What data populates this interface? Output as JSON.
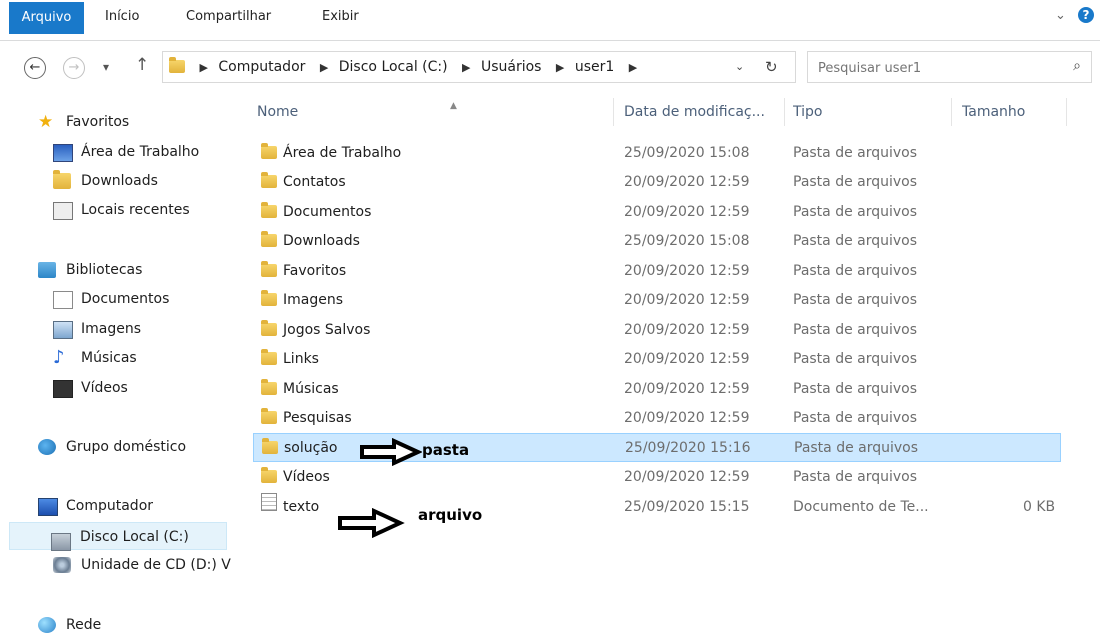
{
  "ribbon": {
    "tabs": [
      "Arquivo",
      "Início",
      "Compartilhar",
      "Exibir"
    ],
    "help": "?"
  },
  "nav": {
    "back": "←",
    "forward": "→",
    "recent": "▾",
    "up": "↑",
    "breadcrumbs": [
      "Computador",
      "Disco Local (C:)",
      "Usuários",
      "user1"
    ],
    "search_placeholder": "Pesquisar user1"
  },
  "sidebar": {
    "favorites": {
      "label": "Favoritos",
      "items": [
        "Área de Trabalho",
        "Downloads",
        "Locais recentes"
      ]
    },
    "libraries": {
      "label": "Bibliotecas",
      "items": [
        "Documentos",
        "Imagens",
        "Músicas",
        "Vídeos"
      ]
    },
    "homegroup": {
      "label": "Grupo doméstico"
    },
    "computer": {
      "label": "Computador",
      "items": [
        "Disco Local (C:)",
        "Unidade de CD (D:) V"
      ]
    },
    "network": {
      "label": "Rede"
    }
  },
  "columns": [
    "Nome",
    "Data de modificaç...",
    "Tipo",
    "Tamanho"
  ],
  "files": [
    {
      "name": "Área de Trabalho",
      "date": "25/09/2020 15:08",
      "type": "Pasta de arquivos",
      "size": ""
    },
    {
      "name": "Contatos",
      "date": "20/09/2020 12:59",
      "type": "Pasta de arquivos",
      "size": ""
    },
    {
      "name": "Documentos",
      "date": "20/09/2020 12:59",
      "type": "Pasta de arquivos",
      "size": ""
    },
    {
      "name": "Downloads",
      "date": "25/09/2020 15:08",
      "type": "Pasta de arquivos",
      "size": ""
    },
    {
      "name": "Favoritos",
      "date": "20/09/2020 12:59",
      "type": "Pasta de arquivos",
      "size": ""
    },
    {
      "name": "Imagens",
      "date": "20/09/2020 12:59",
      "type": "Pasta de arquivos",
      "size": ""
    },
    {
      "name": "Jogos Salvos",
      "date": "20/09/2020 12:59",
      "type": "Pasta de arquivos",
      "size": ""
    },
    {
      "name": "Links",
      "date": "20/09/2020 12:59",
      "type": "Pasta de arquivos",
      "size": ""
    },
    {
      "name": "Músicas",
      "date": "20/09/2020 12:59",
      "type": "Pasta de arquivos",
      "size": ""
    },
    {
      "name": "Pesquisas",
      "date": "20/09/2020 12:59",
      "type": "Pasta de arquivos",
      "size": ""
    },
    {
      "name": "solução",
      "date": "25/09/2020 15:16",
      "type": "Pasta de arquivos",
      "size": ""
    },
    {
      "name": "Vídeos",
      "date": "20/09/2020 12:59",
      "type": "Pasta de arquivos",
      "size": ""
    },
    {
      "name": "texto",
      "date": "25/09/2020 15:15",
      "type": "Documento de Te...",
      "size": "0 KB"
    }
  ],
  "annotations": {
    "folder": "pasta",
    "file": "arquivo"
  }
}
